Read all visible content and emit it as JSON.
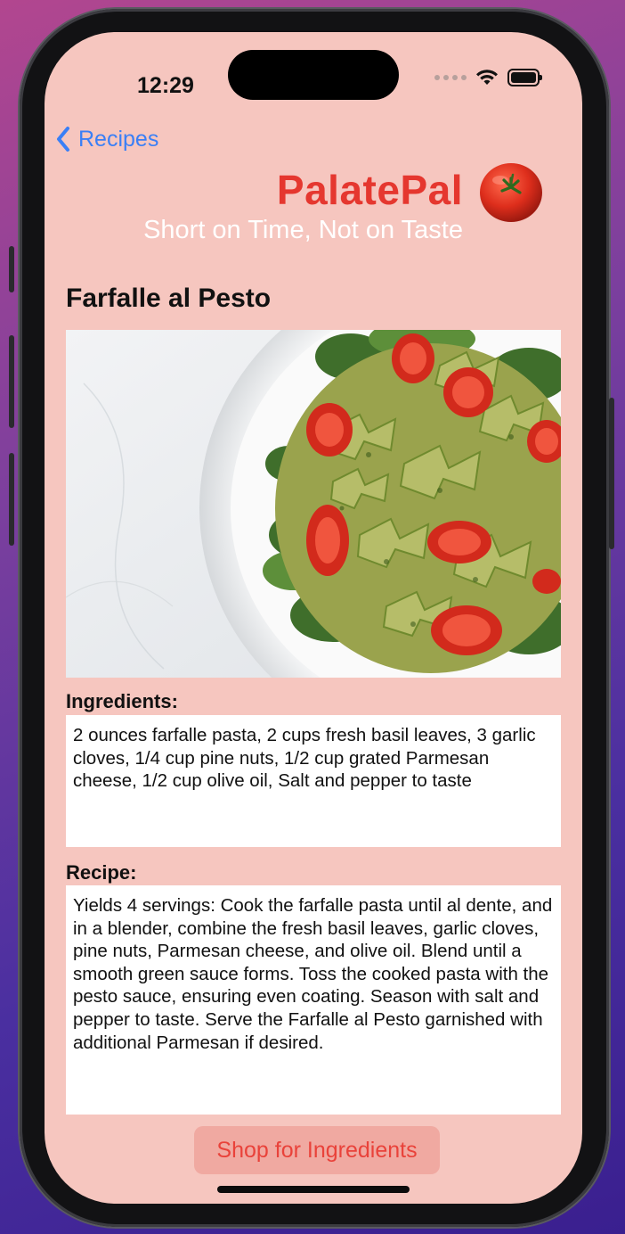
{
  "status_bar": {
    "time": "12:29"
  },
  "nav": {
    "back_label": "Recipes"
  },
  "header": {
    "brand": "PalatePal",
    "tagline": "Short on Time, Not on Taste"
  },
  "recipe": {
    "title": "Farfalle al Pesto",
    "ingredients_label": "Ingredients:",
    "ingredients_text": "2 ounces farfalle pasta, 2 cups fresh basil leaves, 3 garlic cloves, 1/4 cup pine nuts, 1/2 cup grated Parmesan cheese, 1/2 cup olive oil, Salt and pepper to taste",
    "recipe_label": "Recipe:",
    "recipe_text": "Yields 4 servings: Cook the farfalle pasta until al dente, and in a blender, combine the fresh basil leaves, garlic cloves, pine nuts, Parmesan cheese, and olive oil. Blend until a smooth green sauce forms. Toss the cooked pasta with the pesto sauce, ensuring even coating. Season with salt and pepper to taste. Serve the Farfalle al Pesto garnished with additional Parmesan if desired."
  },
  "actions": {
    "shop_label": "Shop for Ingredients"
  },
  "colors": {
    "screen_bg": "#f6c6bf",
    "brand_red": "#e5372f",
    "link_blue": "#3a7ff6",
    "button_bg": "#f0a9a1"
  },
  "icons": {
    "back": "chevron-left-icon",
    "logo": "tomato-icon",
    "signal": "cellular-dots-icon",
    "wifi": "wifi-icon",
    "battery": "battery-icon"
  }
}
